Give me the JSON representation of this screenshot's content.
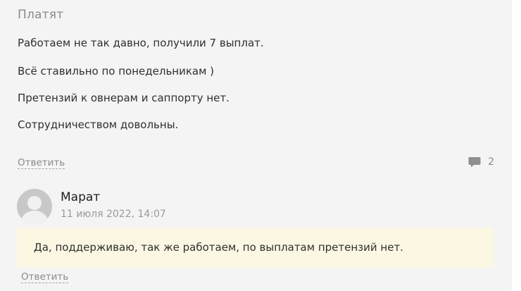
{
  "review": {
    "title": "Платят",
    "paragraphs": [
      "Работаем не так давно, получили 7 выплат.",
      "Всё ставильно по понедельникам )",
      "Претензий к овнерам и саппорту нет.",
      "Сотрудничеством довольны."
    ],
    "reply_label": "Ответить",
    "comment_count": "2",
    "comment_icon": "speech-bubble-icon"
  },
  "comment": {
    "author": "Марат",
    "date": "11 июля 2022, 14:07",
    "text": "Да, поддерживаю, так же работаем, по выплатам претензий нет.",
    "reply_label": "Ответить",
    "avatar_icon": "default-user-avatar-icon"
  },
  "colors": {
    "card_background": "#f4f4f4",
    "reply_background": "#fbf7e3",
    "muted_text": "#8a8a8a"
  }
}
